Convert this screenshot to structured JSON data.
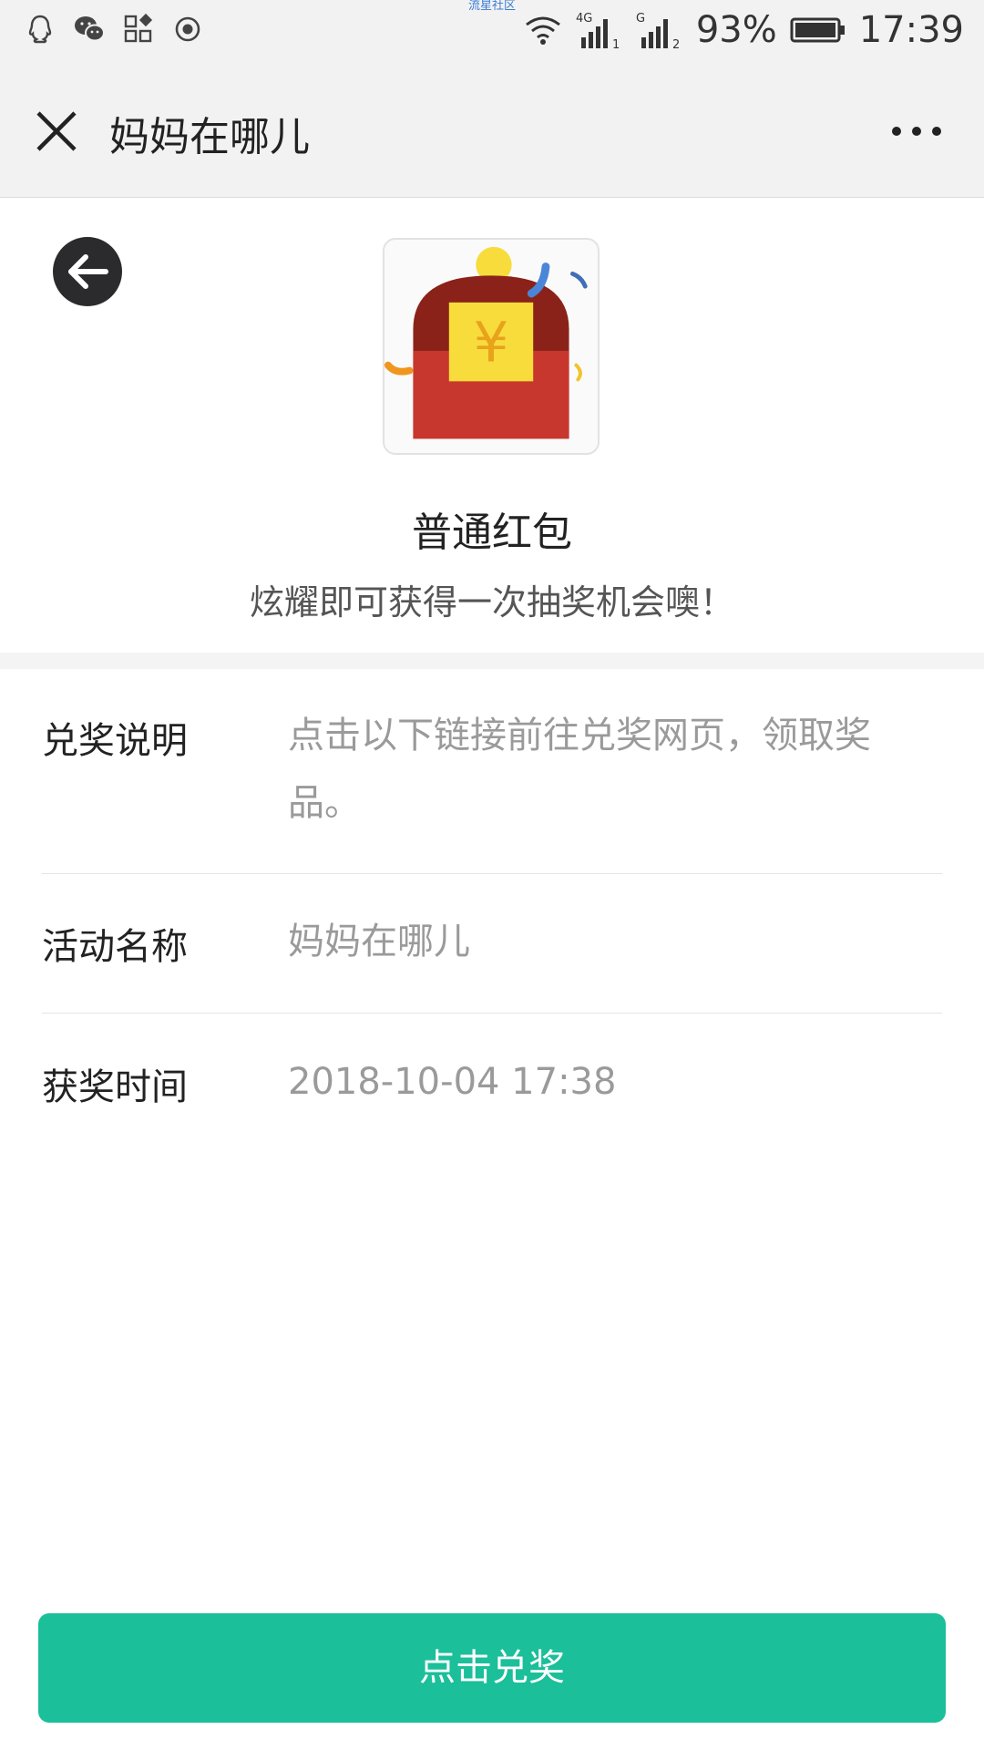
{
  "statusbar": {
    "watermark": "流星社区",
    "network_4g": "4G",
    "network_g": "G",
    "sim1": "1",
    "sim2": "2",
    "battery": "93%",
    "time": "17:39"
  },
  "titlebar": {
    "title": "妈妈在哪儿"
  },
  "card": {
    "title": "普通红包",
    "subtitle": "炫耀即可获得一次抽奖机会噢！",
    "currency_symbol": "¥"
  },
  "details": {
    "redeem_label": "兑奖说明",
    "redeem_value": "点击以下链接前往兑奖网页，领取奖品。",
    "activity_label": "活动名称",
    "activity_value": "妈妈在哪儿",
    "time_label": "获奖时间",
    "time_value": "2018-10-04 17:38"
  },
  "button": {
    "label": "点击兑奖"
  },
  "colors": {
    "accent": "#1bbf9a",
    "envelope_red": "#c8372d",
    "envelope_dark": "#8a2219",
    "coin_yellow": "#f7dc3c"
  }
}
